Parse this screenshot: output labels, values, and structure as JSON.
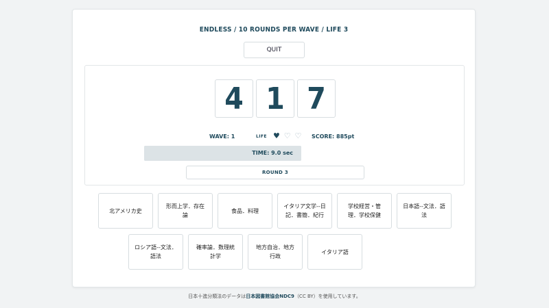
{
  "header": {
    "mode_title": "ENDLESS / 10 ROUNDS PER WAVE / LIFE 3"
  },
  "controls": {
    "quit_label": "QUIT"
  },
  "question": {
    "digits": [
      "4",
      "1",
      "7"
    ]
  },
  "status": {
    "wave": "WAVE: 1",
    "life_label": "LIFE",
    "life_hearts": [
      "♥",
      "♡",
      "♡"
    ],
    "score": "SCORE: 885pt"
  },
  "timer": {
    "text": "TIME: 9.0 sec",
    "remaining_fraction": 1.0
  },
  "round": {
    "label": "ROUND 3"
  },
  "answers": [
    {
      "label": "北アメリカ史"
    },
    {
      "label": "形而上学．存在論"
    },
    {
      "label": "食品．料理"
    },
    {
      "label": "イタリア文学--日記．書簡．紀行"
    },
    {
      "label": "学校経営・管理．学校保健"
    },
    {
      "label": "日本語--文法．語法"
    },
    {
      "label": "ロシア語--文法．語法"
    },
    {
      "label": "確率論．数理統計学"
    },
    {
      "label": "地方自治．地方行政"
    },
    {
      "label": "イタリア語"
    }
  ],
  "footer": {
    "prefix": "日本十進分類法のデータは",
    "source": "日本図書館協会NDC9",
    "suffix": "（CC BY）を使用しています。"
  },
  "colors": {
    "accent": "#1f4a5c",
    "timer_bar": "#dce3e6",
    "background": "#f1f3f4"
  }
}
